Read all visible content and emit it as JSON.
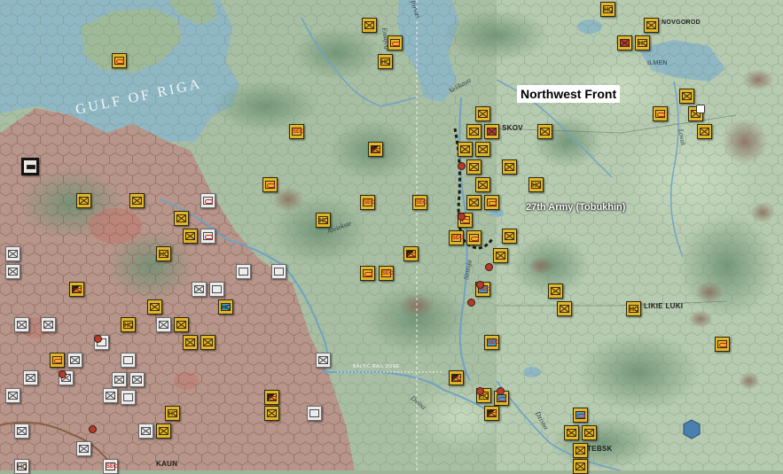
{
  "map": {
    "front_label": "Northwest Front",
    "army_label": "27th Army (Tobukhin)",
    "sea_label": "GULF OF RIGA",
    "zone_label": "BALTIC RAIL ZONE",
    "towns": {
      "pskov": "SKOV",
      "velikie_luki": "LIKIE LUKI",
      "vitebsk": "TEBSK",
      "kaunas": "KAUN",
      "novgorod": "NOVGOROD",
      "lake": "ILMEN"
    },
    "rivers": {
      "emajogi": "Emajogi",
      "aiviekste": "Aiviekste",
      "daugava": "Dvina",
      "ptsva": "Pirvas",
      "velikaya": "Velikaya",
      "lovat": "Lovat",
      "sintoja": "Sintoja",
      "dzisna": "Dzisna"
    },
    "colors": {
      "soviet": "#e3b629",
      "german": "#ececec",
      "water": "#8fb8c6",
      "occupied": "#b88a80",
      "terrain": "#9fb59a"
    },
    "unit_codes": {
      "hq": "HQ",
      "security": "SEC"
    }
  }
}
